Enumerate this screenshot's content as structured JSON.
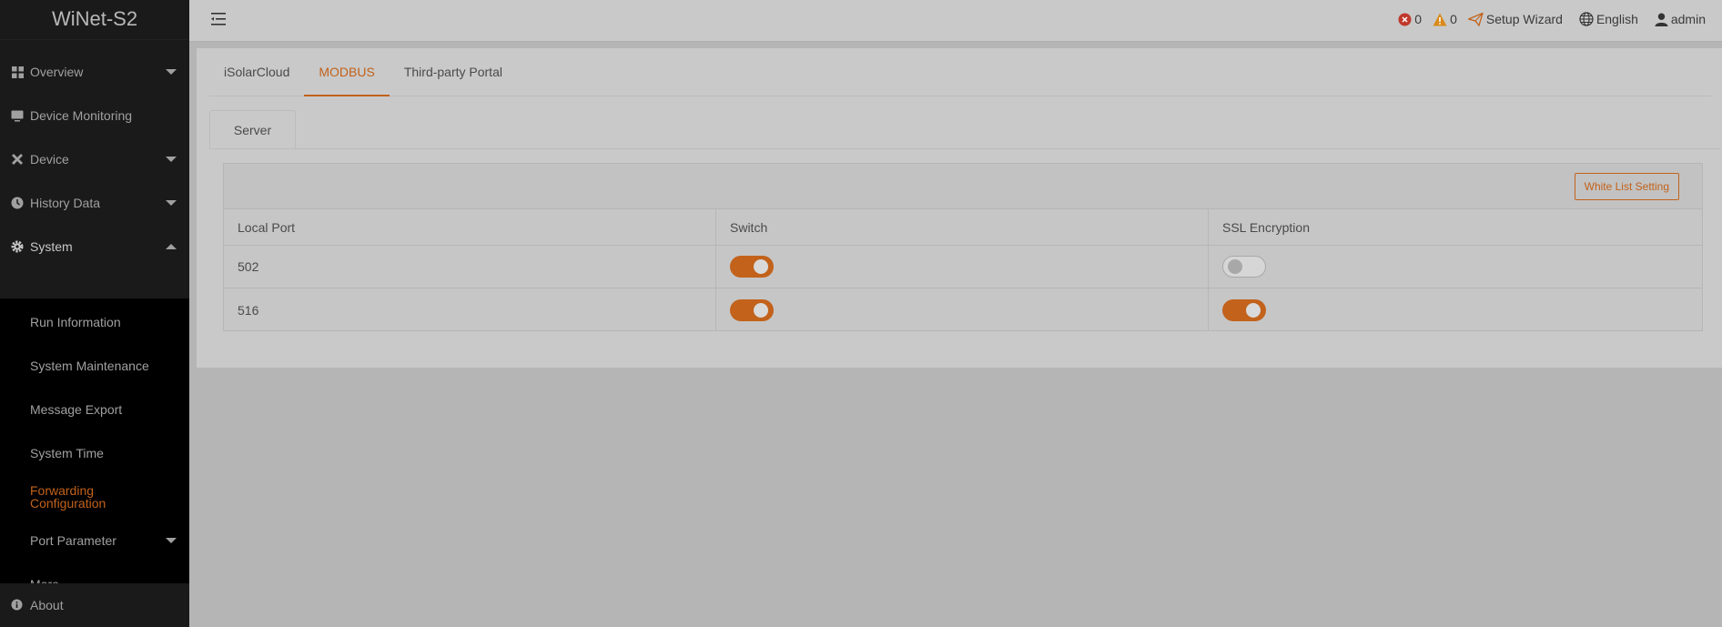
{
  "brand": "WiNet-S2",
  "sidebar": {
    "items": [
      {
        "label": "Overview",
        "icon": "grid-icon"
      },
      {
        "label": "Device Monitoring",
        "icon": "monitor-icon"
      },
      {
        "label": "Device",
        "icon": "tools-icon"
      },
      {
        "label": "History Data",
        "icon": "clock-icon"
      },
      {
        "label": "System",
        "icon": "gear-icon"
      }
    ],
    "submenu": [
      {
        "label": "Run Information"
      },
      {
        "label": "System Maintenance"
      },
      {
        "label": "Message Export"
      },
      {
        "label": "System Time"
      },
      {
        "label": "Forwarding Configuration"
      },
      {
        "label": "Port Parameter"
      },
      {
        "label": "More"
      }
    ],
    "about": "About"
  },
  "header": {
    "error_count": "0",
    "warning_count": "0",
    "setup_wizard": "Setup Wizard",
    "language": "English",
    "user": "admin"
  },
  "tabs": [
    {
      "label": "iSolarCloud"
    },
    {
      "label": "MODBUS"
    },
    {
      "label": "Third-party Portal"
    }
  ],
  "subtab": "Server",
  "table": {
    "white_list_button": "White List Setting",
    "columns": [
      "Local Port",
      "Switch",
      "SSL Encryption"
    ],
    "rows": [
      {
        "port": "502",
        "switch": true,
        "ssl": false
      },
      {
        "port": "516",
        "switch": true,
        "ssl": true
      }
    ]
  },
  "colors": {
    "accent": "#c2621b",
    "error": "#c0392b",
    "warning": "#d98a1a"
  }
}
